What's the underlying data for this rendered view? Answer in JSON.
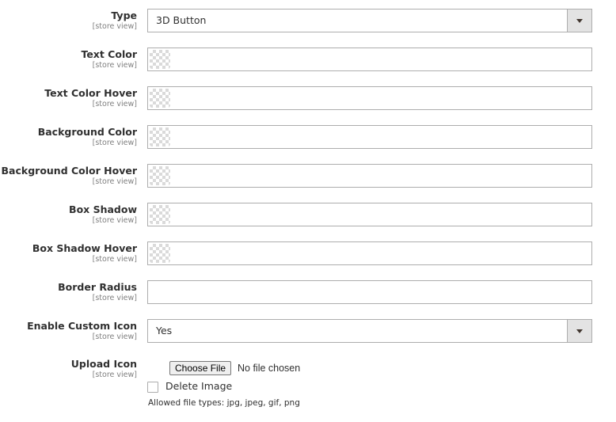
{
  "fields": [
    {
      "id": "type",
      "label": "Type",
      "scope": "[store view]",
      "kind": "select",
      "value": "3D Button"
    },
    {
      "id": "text-color",
      "label": "Text Color",
      "scope": "[store view]",
      "kind": "color",
      "value": ""
    },
    {
      "id": "text-color-hover",
      "label": "Text Color Hover",
      "scope": "[store view]",
      "kind": "color",
      "value": ""
    },
    {
      "id": "background-color",
      "label": "Background Color",
      "scope": "[store view]",
      "kind": "color",
      "value": ""
    },
    {
      "id": "background-color-hover",
      "label": "Background Color Hover",
      "scope": "[store view]",
      "kind": "color",
      "value": ""
    },
    {
      "id": "box-shadow",
      "label": "Box Shadow",
      "scope": "[store view]",
      "kind": "color",
      "value": ""
    },
    {
      "id": "box-shadow-hover",
      "label": "Box Shadow Hover",
      "scope": "[store view]",
      "kind": "color",
      "value": ""
    },
    {
      "id": "border-radius",
      "label": "Border Radius",
      "scope": "[store view]",
      "kind": "text",
      "value": ""
    },
    {
      "id": "enable-custom-icon",
      "label": "Enable Custom Icon",
      "scope": "[store view]",
      "kind": "select",
      "value": "Yes"
    }
  ],
  "upload": {
    "label": "Upload Icon",
    "scope": "[store view]",
    "button_label": "Choose File",
    "status": "No file chosen",
    "delete_label": "Delete Image",
    "note": "Allowed file types: jpg, jpeg, gif, png"
  }
}
